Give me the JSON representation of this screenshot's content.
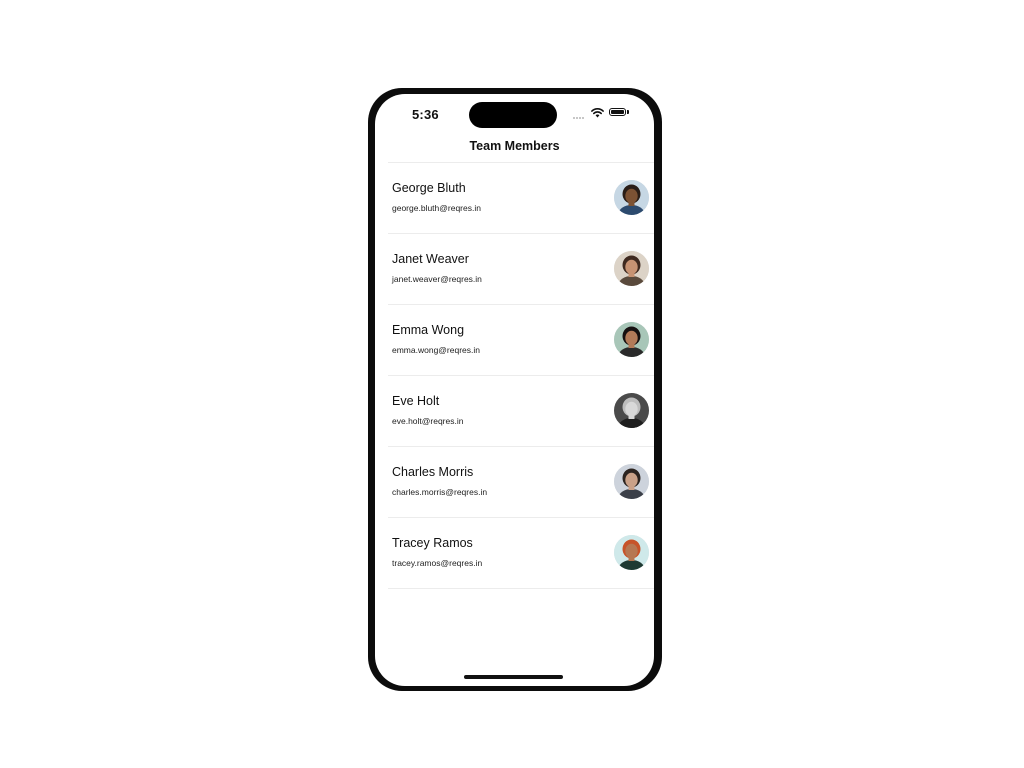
{
  "status_bar": {
    "time": "5:36"
  },
  "nav": {
    "title": "Team Members"
  },
  "members": [
    {
      "name": "George Bluth",
      "email": "george.bluth@reqres.in",
      "avatar_bg": "#c6d7e4",
      "skin": "#7c5234",
      "hair": "#2a1e18",
      "shirt": "#2c4a6e"
    },
    {
      "name": "Janet Weaver",
      "email": "janet.weaver@reqres.in",
      "avatar_bg": "#dcd3c7",
      "skin": "#c79373",
      "hair": "#3f2a20",
      "shirt": "#5a4a3c"
    },
    {
      "name": "Emma Wong",
      "email": "emma.wong@reqres.in",
      "avatar_bg": "#a8c6b8",
      "skin": "#b27a58",
      "hair": "#161010",
      "shirt": "#2a2a2a"
    },
    {
      "name": "Eve Holt",
      "email": "eve.holt@reqres.in",
      "avatar_bg": "#4a4a4a",
      "skin": "#d8d8d8",
      "hair": "#bdbdbd",
      "shirt": "#1e1e1e"
    },
    {
      "name": "Charles Morris",
      "email": "charles.morris@reqres.in",
      "avatar_bg": "#cdd3dc",
      "skin": "#caa188",
      "hair": "#2c2420",
      "shirt": "#3b3f48"
    },
    {
      "name": "Tracey Ramos",
      "email": "tracey.ramos@reqres.in",
      "avatar_bg": "#cfe9ea",
      "skin": "#b67752",
      "hair": "#c7542a",
      "shirt": "#1f3a33"
    }
  ]
}
